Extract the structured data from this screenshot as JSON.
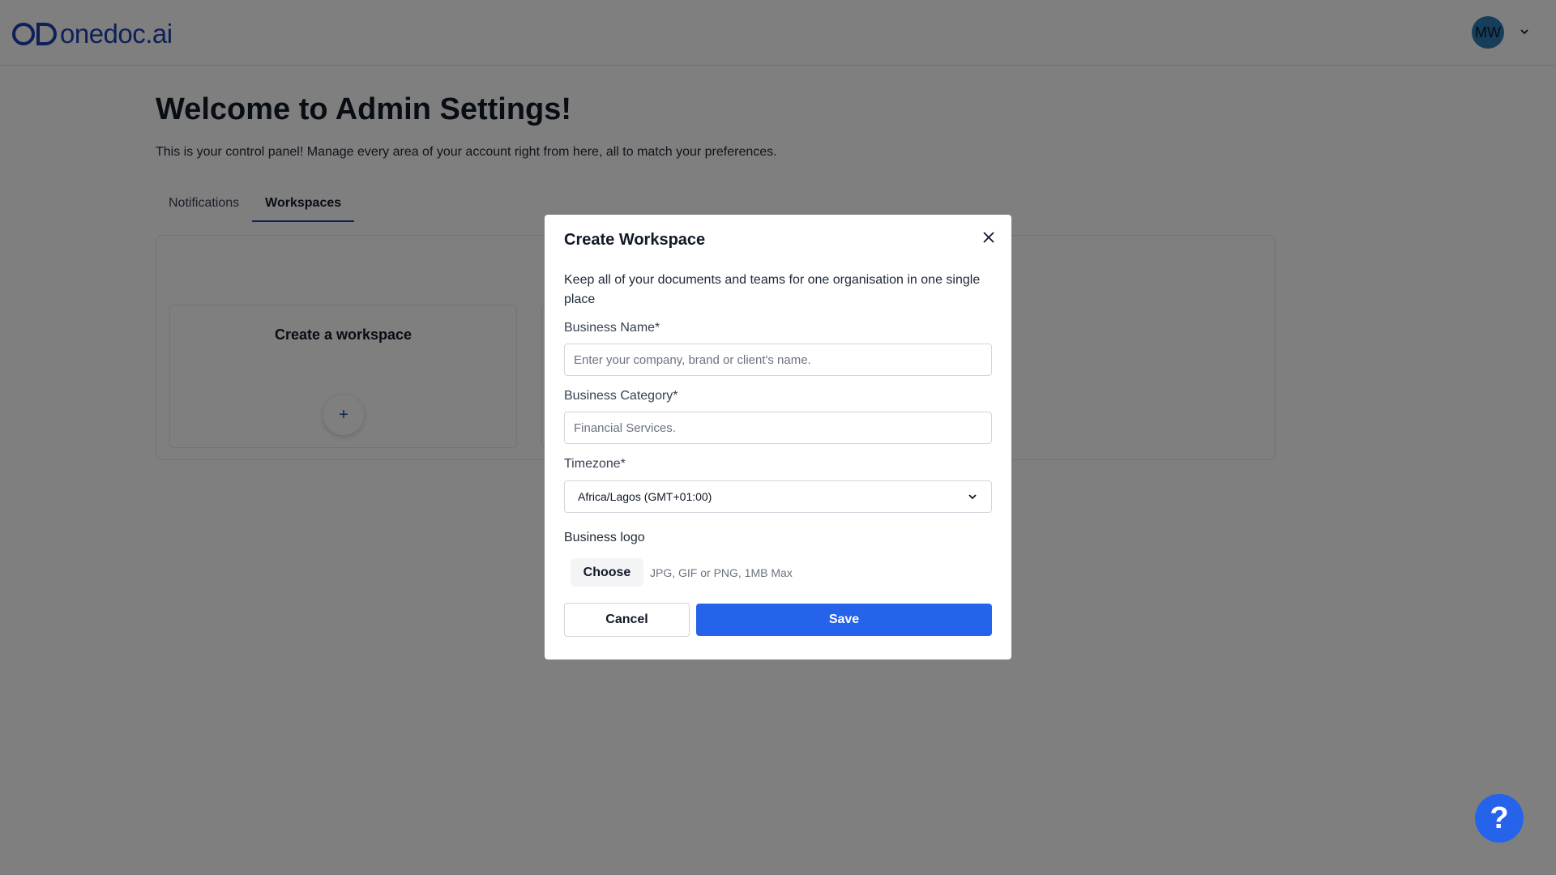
{
  "brand": {
    "name": "onedoc.ai",
    "color": "#1e40af"
  },
  "user": {
    "initials": "MW"
  },
  "page": {
    "title": "Welcome to Admin Settings!",
    "subtitle": "This is your control panel! Manage every area of your account right from here, all to match your preferences."
  },
  "tabs": [
    {
      "label": "Notifications",
      "active": false
    },
    {
      "label": "Workspaces",
      "active": true
    }
  ],
  "workspace_card": {
    "title": "Create a workspace",
    "add_symbol": "+"
  },
  "modal": {
    "title": "Create Workspace",
    "description": "Keep all of your documents and teams for one organisation in one single place",
    "business_name": {
      "label": "Business Name*",
      "value": "",
      "placeholder": "Enter your company, brand or client's name."
    },
    "business_category": {
      "label": "Business Category*",
      "value": "",
      "placeholder": "Financial Services."
    },
    "timezone": {
      "label": "Timezone*",
      "selected": "Africa/Lagos (GMT+01:00)"
    },
    "logo": {
      "label": "Business logo",
      "choose_label": "Choose",
      "hint": "JPG, GIF or PNG, 1MB Max"
    },
    "cancel_label": "Cancel",
    "save_label": "Save"
  },
  "help": {
    "symbol": "?"
  },
  "colors": {
    "accent": "#2563eb",
    "overlay": "rgba(0,0,0,0.5)"
  }
}
